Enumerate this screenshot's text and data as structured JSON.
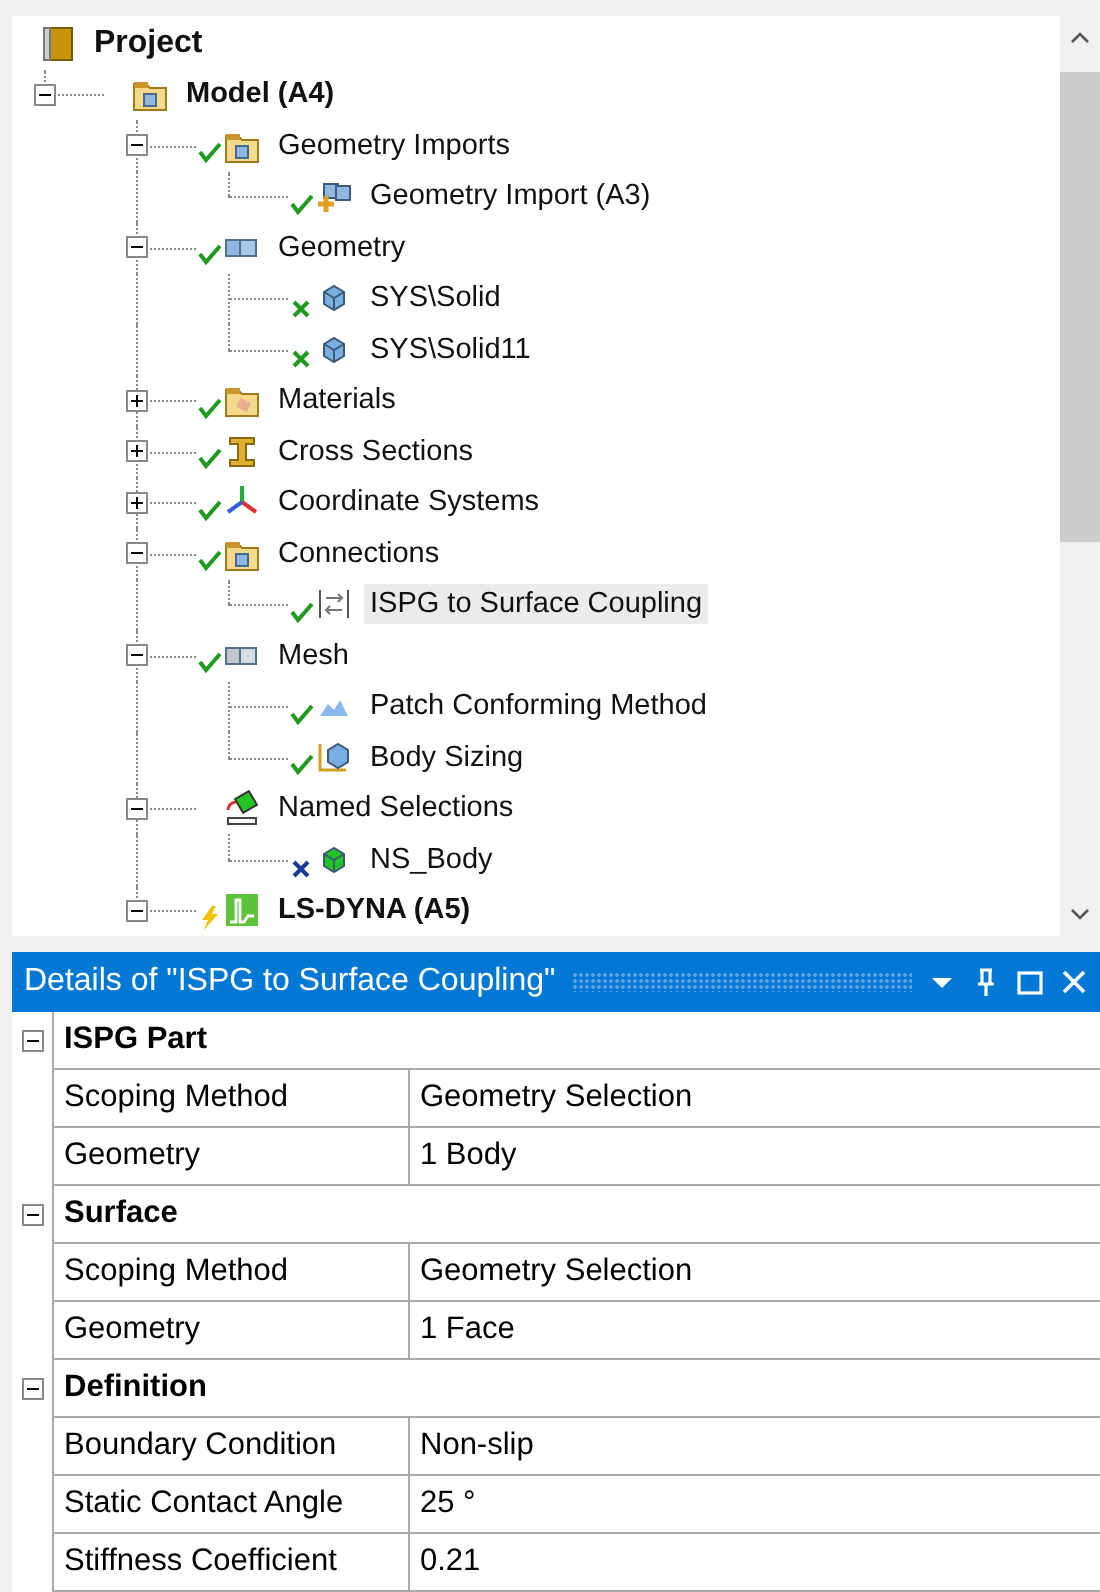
{
  "tree": [
    {
      "label": "Project",
      "kind": "project",
      "selected": false,
      "children": [
        {
          "label": "Model (A4)",
          "kind": "model",
          "expanded": true,
          "selected": false,
          "children": [
            {
              "label": "Geometry Imports",
              "kind": "imports",
              "status": {
                "kind": "check"
              },
              "expanded": true,
              "selected": false,
              "children": [
                {
                  "label": "Geometry Import (A3)",
                  "kind": "import",
                  "status": {
                    "kind": "check"
                  },
                  "selected": false
                }
              ]
            },
            {
              "label": "Geometry",
              "kind": "geometry",
              "status": {
                "kind": "check"
              },
              "expanded": true,
              "selected": false,
              "children": [
                {
                  "label": "SYS\\Solid",
                  "kind": "part",
                  "status": {
                    "kind": "partial"
                  },
                  "selected": false
                },
                {
                  "label": "SYS\\Solid11",
                  "kind": "part",
                  "status": {
                    "kind": "partial"
                  },
                  "selected": false
                }
              ]
            },
            {
              "label": "Materials",
              "kind": "materials",
              "status": {
                "kind": "check"
              },
              "expanded": false,
              "selected": false
            },
            {
              "label": "Cross Sections",
              "kind": "cross-section",
              "status": {
                "kind": "check"
              },
              "expanded": false,
              "selected": false
            },
            {
              "label": "Coordinate Systems",
              "kind": "coordinates",
              "status": {
                "kind": "check"
              },
              "expanded": false,
              "selected": false
            },
            {
              "label": "Connections",
              "kind": "connections",
              "status": {
                "kind": "check"
              },
              "expanded": true,
              "selected": false,
              "children": [
                {
                  "label": "ISPG to Surface Coupling",
                  "kind": "coupling",
                  "status": {
                    "kind": "check"
                  },
                  "selected": true
                }
              ]
            },
            {
              "label": "Mesh",
              "kind": "mesh",
              "status": {
                "kind": "check"
              },
              "expanded": true,
              "selected": false,
              "children": [
                {
                  "label": "Patch Conforming Method",
                  "kind": "method",
                  "status": {
                    "kind": "check"
                  },
                  "selected": false
                },
                {
                  "label": "Body Sizing",
                  "kind": "sizing",
                  "status": {
                    "kind": "check"
                  },
                  "selected": false
                }
              ]
            },
            {
              "label": "Named Selections",
              "kind": "named-selection",
              "expanded": true,
              "selected": false,
              "children": [
                {
                  "label": "NS_Body",
                  "kind": "named-body",
                  "status": {
                    "kind": "cross"
                  },
                  "selected": false
                }
              ]
            },
            {
              "label": "LS-DYNA (A5)",
              "kind": "solver",
              "status": {
                "kind": "bolt"
              },
              "expanded": true,
              "selected": false
            }
          ]
        }
      ]
    }
  ],
  "details": {
    "title": "Details of \"ISPG to Surface Coupling\"",
    "sections": [
      {
        "title": "ISPG Part",
        "expanded": true,
        "rows": [
          {
            "name": "Scoping Method",
            "value": "Geometry Selection"
          },
          {
            "name": "Geometry",
            "value": "1 Body"
          }
        ]
      },
      {
        "title": "Surface",
        "expanded": true,
        "rows": [
          {
            "name": "Scoping Method",
            "value": "Geometry Selection"
          },
          {
            "name": "Geometry",
            "value": "1 Face"
          }
        ]
      },
      {
        "title": "Definition",
        "expanded": true,
        "rows": [
          {
            "name": "Boundary Condition",
            "value": "Non-slip"
          },
          {
            "name": "Static Contact Angle",
            "value": "25 °"
          },
          {
            "name": "Stiffness Coefficient",
            "value": "0.21"
          }
        ]
      }
    ]
  }
}
